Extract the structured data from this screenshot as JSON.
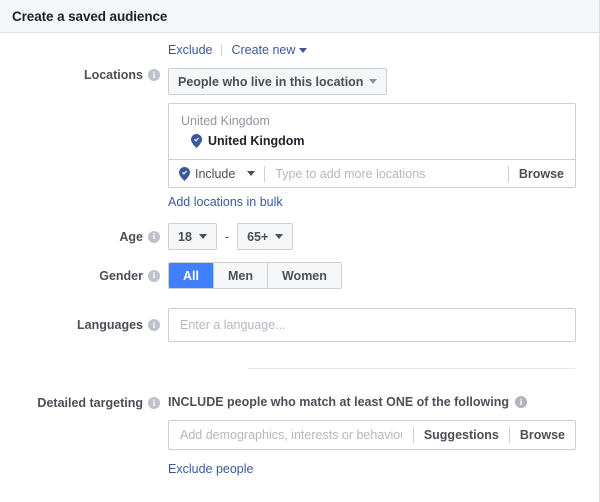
{
  "header": {
    "title": "Create a saved audience"
  },
  "top_actions": {
    "exclude_label": "Exclude",
    "create_new_label": "Create new"
  },
  "locations": {
    "label": "Locations",
    "dropdown_value": "People who live in this location",
    "section_title": "United Kingdom",
    "selected_item": "United Kingdom",
    "include_label": "Include",
    "input_placeholder": "Type to add more locations",
    "input_value": "",
    "browse_label": "Browse",
    "bulk_link": "Add locations in bulk"
  },
  "age": {
    "label": "Age",
    "min": "18",
    "max": "65+",
    "dash": "-"
  },
  "gender": {
    "label": "Gender",
    "options": [
      {
        "label": "All",
        "selected": true
      },
      {
        "label": "Men",
        "selected": false
      },
      {
        "label": "Women",
        "selected": false
      }
    ]
  },
  "languages": {
    "label": "Languages",
    "placeholder": "Enter a language...",
    "value": ""
  },
  "detailed_targeting": {
    "label": "Detailed targeting",
    "heading": "INCLUDE people who match at least ONE of the following",
    "placeholder": "Add demographics, interests or behaviours",
    "value": "",
    "suggestions_label": "Suggestions",
    "browse_label": "Browse",
    "exclude_link": "Exclude people"
  },
  "colors": {
    "accent_blue": "#4080ff",
    "link_blue": "#3b5998",
    "pin_blue": "#3b5998",
    "header_bg": "#f5f6f7",
    "border": "#ccd0d5",
    "label_gray": "#4b4f56",
    "placeholder_gray": "#b3b8bf"
  }
}
